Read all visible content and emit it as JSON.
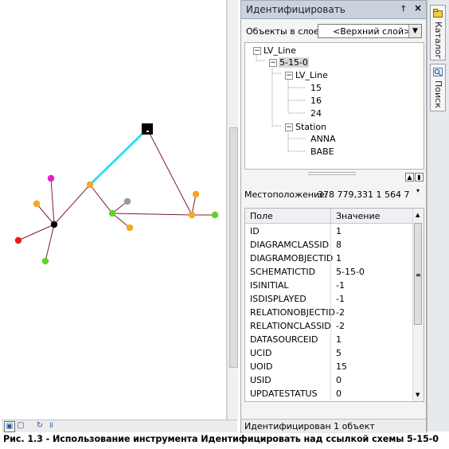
{
  "identify_window": {
    "title": "Идентифицировать",
    "pin_label": "†",
    "close_label": "×",
    "layer_label": "Объекты в слое:",
    "layer_value": "<Верхний слой>",
    "tree": [
      {
        "label": "LV_Line",
        "expander": "−"
      },
      {
        "label": "5-15-0",
        "expander": "−"
      },
      {
        "label": "LV_Line",
        "expander": "−"
      },
      {
        "label": "15"
      },
      {
        "label": "16"
      },
      {
        "label": "24"
      },
      {
        "label": "Station",
        "expander": "−"
      },
      {
        "label": "ANNA"
      },
      {
        "label": "BABE"
      }
    ],
    "location_label": "Местоположение:",
    "location_value": "378 779,331  1 564 7",
    "grid": {
      "col_field": "Поле",
      "col_value": "Значение",
      "rows": [
        {
          "field": "ID",
          "value": "1"
        },
        {
          "field": "DIAGRAMCLASSID",
          "value": "8"
        },
        {
          "field": "DIAGRAMOBJECTID",
          "value": "1"
        },
        {
          "field": "SCHEMATICTID",
          "value": "5-15-0"
        },
        {
          "field": "ISINITIAL",
          "value": "-1"
        },
        {
          "field": "ISDISPLAYED",
          "value": "-1"
        },
        {
          "field": "RELATIONOBJECTID",
          "value": "-2"
        },
        {
          "field": "RELATIONCLASSID",
          "value": "-2"
        },
        {
          "field": "DATASOURCEID",
          "value": "1"
        },
        {
          "field": "UCID",
          "value": "5"
        },
        {
          "field": "UOID",
          "value": "15"
        },
        {
          "field": "USID",
          "value": "0"
        },
        {
          "field": "UPDATESTATUS",
          "value": "0"
        }
      ]
    },
    "status": "Идентифицирован 1 объект"
  },
  "dock": {
    "catalog_label": "Каталог",
    "search_label": "Поиск"
  },
  "map": {
    "colors": {
      "link": "#7a1f2e",
      "selected_link": "#33e0f0",
      "junction_orange": "#f5a623",
      "junction_green": "#5ed42a",
      "junction_red": "#e61e1e",
      "junction_magenta": "#e81ec8",
      "junction_gray": "#9a9a9a",
      "junction_black": "#000000"
    }
  },
  "caption": "Рис. 1.3 - Использование инструмента Идентифицировать над ссылкой схемы 5-15-0"
}
